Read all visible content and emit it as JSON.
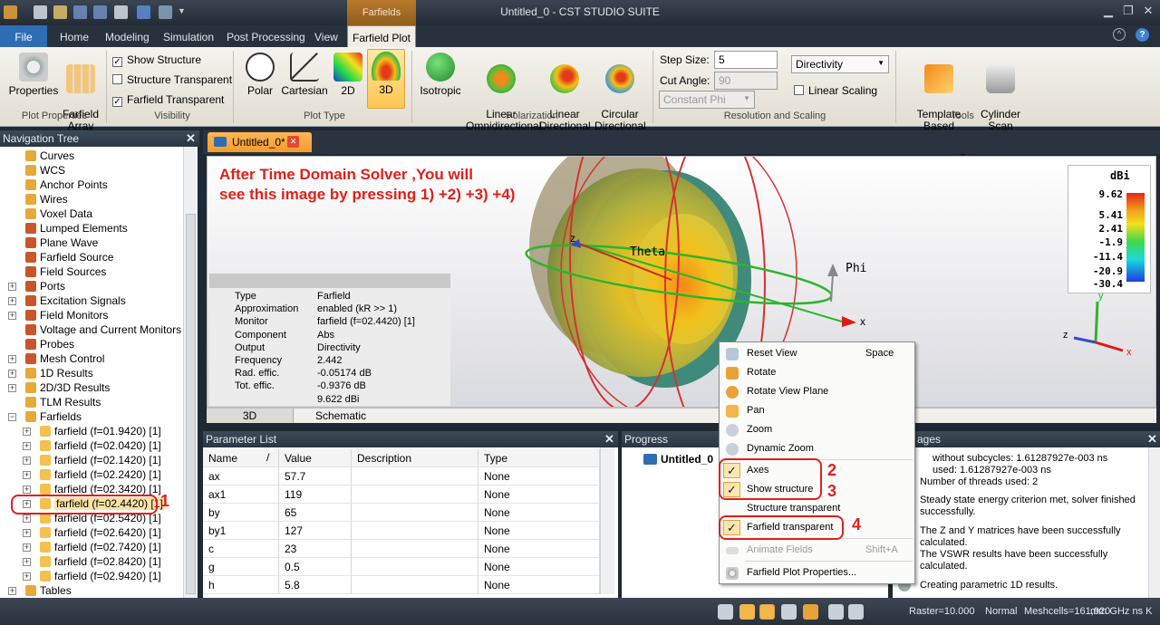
{
  "window": {
    "title": "Untitled_0 - CST STUDIO SUITE",
    "context_tab_header": "Farfields"
  },
  "tabs": [
    {
      "label": "File"
    },
    {
      "label": "Home"
    },
    {
      "label": "Modeling"
    },
    {
      "label": "Simulation"
    },
    {
      "label": "Post Processing"
    },
    {
      "label": "View"
    },
    {
      "label": "Farfield Plot"
    }
  ],
  "ribbon": {
    "plot_properties": {
      "group": "Plot Properties",
      "properties": "Properties",
      "farfield_array": "Farfield\nArray"
    },
    "visibility": {
      "group": "Visibility",
      "show_structure": "Show Structure",
      "structure_transparent": "Structure Transparent",
      "farfield_transparent": "Farfield Transparent"
    },
    "plot_type": {
      "group": "Plot Type",
      "polar": "Polar",
      "cartesian": "Cartesian",
      "twod": "2D",
      "threed": "3D"
    },
    "polarization": {
      "group": "Polarization",
      "isotropic": "Isotropic",
      "linear_omni": "Linear\nOmnidirectional",
      "linear_dir": "Linear\nDirectional",
      "circular_dir": "Circular\nDirectional"
    },
    "resolution": {
      "group": "Resolution and Scaling",
      "step_size_label": "Step Size:",
      "step_size_value": "5",
      "cut_angle_label": "Cut Angle:",
      "cut_angle_value": "90",
      "cut_mode": "Constant Phi",
      "quantity": "Directivity",
      "linear_scaling": "Linear Scaling"
    },
    "tools": {
      "group": "Tools",
      "template": "Template Based\nPost Processing",
      "cylinder": "Cylinder\nScan"
    }
  },
  "nav": {
    "title": "Navigation Tree",
    "items": [
      {
        "label": "Curves",
        "indent": 1,
        "icon": "#e6a93a",
        "exp": false
      },
      {
        "label": "WCS",
        "indent": 1,
        "icon": "#e6a93a",
        "exp": false
      },
      {
        "label": "Anchor Points",
        "indent": 1,
        "icon": "#e6a93a",
        "exp": false
      },
      {
        "label": "Wires",
        "indent": 1,
        "icon": "#e6a93a",
        "exp": false
      },
      {
        "label": "Voxel Data",
        "indent": 1,
        "icon": "#e6a93a",
        "exp": false
      },
      {
        "label": "Lumped Elements",
        "indent": 1,
        "icon": "#c9552b",
        "exp": false
      },
      {
        "label": "Plane Wave",
        "indent": 1,
        "icon": "#c9552b",
        "exp": false
      },
      {
        "label": "Farfield Source",
        "indent": 1,
        "icon": "#c9552b",
        "exp": false
      },
      {
        "label": "Field Sources",
        "indent": 1,
        "icon": "#c9552b",
        "exp": false
      },
      {
        "label": "Ports",
        "indent": 1,
        "icon": "#c9552b",
        "exp": true
      },
      {
        "label": "Excitation Signals",
        "indent": 1,
        "icon": "#c9552b",
        "exp": true
      },
      {
        "label": "Field Monitors",
        "indent": 1,
        "icon": "#c9552b",
        "exp": true
      },
      {
        "label": "Voltage and Current Monitors",
        "indent": 1,
        "icon": "#c9552b",
        "exp": false
      },
      {
        "label": "Probes",
        "indent": 1,
        "icon": "#c9552b",
        "exp": false
      },
      {
        "label": "Mesh Control",
        "indent": 1,
        "icon": "#c9552b",
        "exp": true
      },
      {
        "label": "1D Results",
        "indent": 1,
        "icon": "#e6a93a",
        "exp": true
      },
      {
        "label": "2D/3D Results",
        "indent": 1,
        "icon": "#e6a93a",
        "exp": true
      },
      {
        "label": "TLM Results",
        "indent": 1,
        "icon": "#e6a93a",
        "exp": false
      },
      {
        "label": "Farfields",
        "indent": 1,
        "icon": "#e6a93a",
        "exp": true
      },
      {
        "label": "farfield (f=01.9420) [1]",
        "indent": 2,
        "icon": "#f2c14e",
        "exp": true
      },
      {
        "label": "farfield (f=02.0420) [1]",
        "indent": 2,
        "icon": "#f2c14e",
        "exp": true
      },
      {
        "label": "farfield (f=02.1420) [1]",
        "indent": 2,
        "icon": "#f2c14e",
        "exp": true
      },
      {
        "label": "farfield (f=02.2420) [1]",
        "indent": 2,
        "icon": "#f2c14e",
        "exp": true
      },
      {
        "label": "farfield (f=02.3420) [1]",
        "indent": 2,
        "icon": "#f2c14e",
        "exp": true
      },
      {
        "label": "farfield (f=02.4420) [1]",
        "indent": 2,
        "icon": "#f2c14e",
        "exp": true,
        "selected": true
      },
      {
        "label": "farfield (f=02.5420) [1]",
        "indent": 2,
        "icon": "#f2c14e",
        "exp": true
      },
      {
        "label": "farfield (f=02.6420) [1]",
        "indent": 2,
        "icon": "#f2c14e",
        "exp": true
      },
      {
        "label": "farfield (f=02.7420) [1]",
        "indent": 2,
        "icon": "#f2c14e",
        "exp": true
      },
      {
        "label": "farfield (f=02.8420) [1]",
        "indent": 2,
        "icon": "#f2c14e",
        "exp": true
      },
      {
        "label": "farfield (f=02.9420) [1]",
        "indent": 2,
        "icon": "#f2c14e",
        "exp": true
      },
      {
        "label": "Tables",
        "indent": 1,
        "icon": "#e6a93a",
        "exp": true
      }
    ]
  },
  "document": {
    "tab": "Untitled_0*",
    "bottom_tab_1": "3D",
    "bottom_tab_2": "Schematic"
  },
  "viewport": {
    "annotation_line1": "After Time Domain Solver ,You will",
    "annotation_line2": "see this image by pressing 1) +2) +3) +4)",
    "axis_theta": "Theta",
    "axis_phi": "Phi",
    "axis_z": "z",
    "axis_x": "x",
    "mini_y": "y",
    "mini_z": "z",
    "mini_x": "x"
  },
  "info": [
    {
      "key": "Type",
      "value": "Farfield"
    },
    {
      "key": "Approximation",
      "value": "enabled (kR >> 1)"
    },
    {
      "key": "Monitor",
      "value": "farfield (f=02.4420) [1]"
    },
    {
      "key": "Component",
      "value": "Abs"
    },
    {
      "key": "Output",
      "value": "Directivity"
    },
    {
      "key": "Frequency",
      "value": "2.442"
    },
    {
      "key": "Rad. effic.",
      "value": "-0.05174 dB"
    },
    {
      "key": "Tot. effic.",
      "value": "-0.9376 dB"
    },
    {
      "key": "",
      "value": "9.622 dBi"
    }
  ],
  "legend": {
    "unit": "dBi",
    "ticks": [
      "9.62",
      "5.41",
      "2.41",
      "-1.9",
      "-11.4",
      "-20.9",
      "-30.4"
    ]
  },
  "params": {
    "title": "Parameter List",
    "headers": [
      "Name",
      "/",
      "Value",
      "Description",
      "Type"
    ],
    "rows": [
      {
        "name": "ax",
        "value": "57.7",
        "type": "None"
      },
      {
        "name": "ax1",
        "value": "119",
        "type": "None"
      },
      {
        "name": "by",
        "value": "65",
        "type": "None"
      },
      {
        "name": "by1",
        "value": "127",
        "type": "None"
      },
      {
        "name": "c",
        "value": "23",
        "type": "None"
      },
      {
        "name": "g",
        "value": "0.5",
        "type": "None"
      },
      {
        "name": "h",
        "value": "5.8",
        "type": "None"
      }
    ]
  },
  "progress": {
    "title": "Progress",
    "item": "Untitled_0"
  },
  "messages": {
    "title": "ages",
    "lines": [
      "without subcycles: 1.61287927e-003 ns",
      "used: 1.61287927e-003 ns",
      "Number of threads used: 2",
      "Steady state energy criterion met, solver finished successfully.",
      "The Z and Y matrices have been successfully calculated.",
      "The VSWR results have been successfully calculated.",
      "Creating parametric 1D results."
    ]
  },
  "context_menu": {
    "reset_view": "Reset View",
    "reset_view_sc": "Space",
    "rotate": "Rotate",
    "rotate_plane": "Rotate View Plane",
    "pan": "Pan",
    "zoom": "Zoom",
    "dynamic_zoom": "Dynamic Zoom",
    "axes": "Axes",
    "show_structure": "Show structure",
    "structure_transparent": "Structure transparent",
    "farfield_transparent": "Farfield transparent",
    "animate": "Animate Fields",
    "animate_sc": "Shift+A",
    "properties": "Farfield Plot Properties..."
  },
  "markers": {
    "m1": "1",
    "m2": "2",
    "m3": "3",
    "m4": "4"
  },
  "status": {
    "raster": "Raster=10.000",
    "mode": "Normal",
    "meshcells": "Meshcells=161,920",
    "units": "mm  GHz  ns  K"
  }
}
